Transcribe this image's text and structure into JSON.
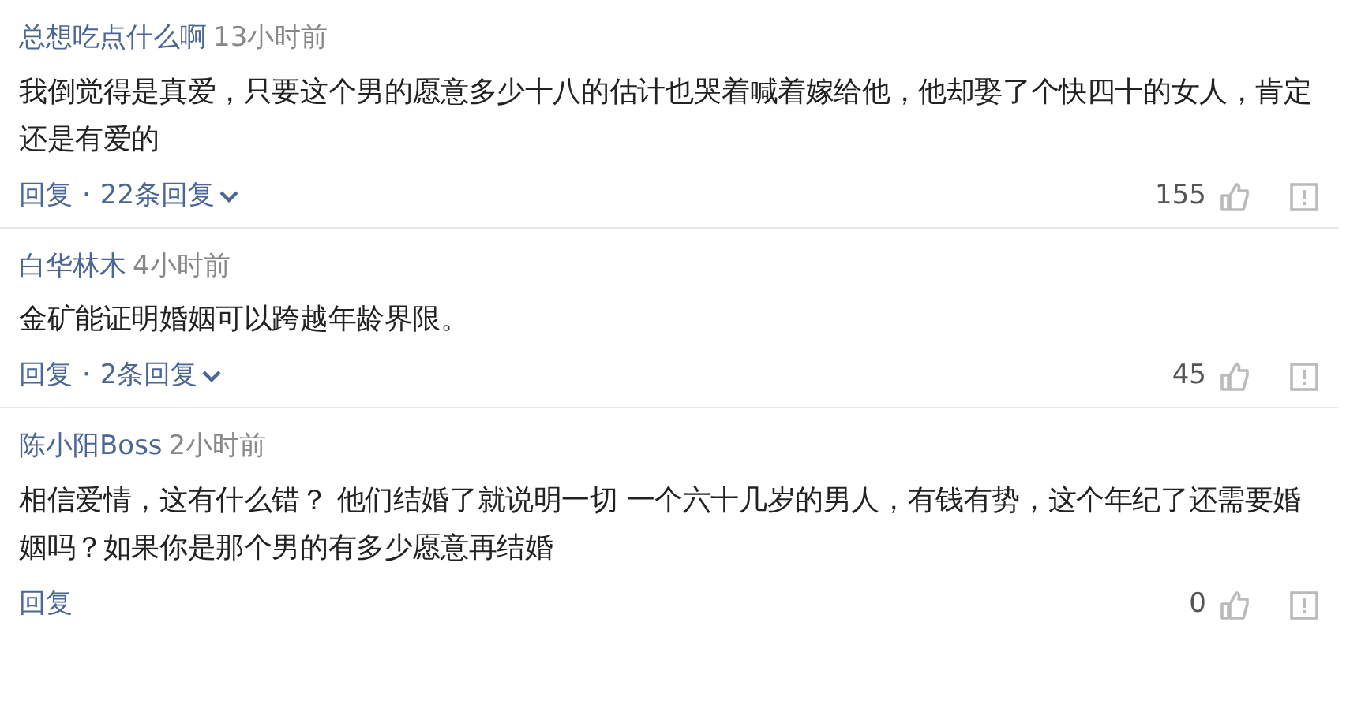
{
  "comments": [
    {
      "user": "总想吃点什么啊",
      "time": "13小时前",
      "text": "我倒觉得是真爱，只要这个男的愿意多少十八的估计也哭着喊着嫁给他，他却娶了个快四十的女人，肯定还是有爱的",
      "reply": "回复",
      "separator": "·",
      "replies": "22条回复",
      "likes": "155"
    },
    {
      "user": "白华林木",
      "time": "4小时前",
      "text": "金矿能证明婚姻可以跨越年龄界限。",
      "reply": "回复",
      "separator": "·",
      "replies": "2条回复",
      "likes": "45"
    },
    {
      "user": "陈小阳Boss",
      "time": "2小时前",
      "text": "相信爱情，这有什么错？ 他们结婚了就说明一切 一个六十几岁的男人，有钱有势，这个年纪了还需要婚姻吗？如果你是那个男的有多少愿意再结婚",
      "reply": "回复",
      "likes": "0"
    }
  ]
}
